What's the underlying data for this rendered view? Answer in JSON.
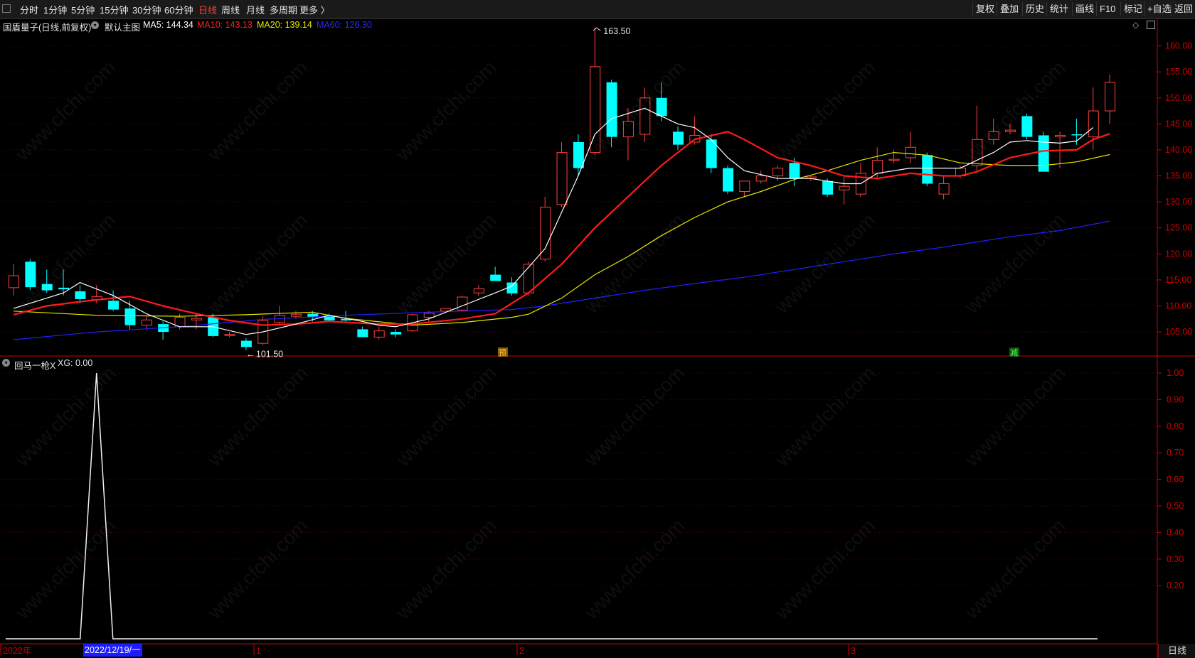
{
  "toolbar": {
    "periods": [
      "分时",
      "1分钟",
      "5分钟",
      "15分钟",
      "30分钟",
      "60分钟",
      "日线",
      "周线",
      "月线",
      "多周期",
      "更多 〉"
    ],
    "active_period": "日线",
    "right_buttons": [
      "复权",
      "叠加",
      "历史",
      "统计",
      "画线",
      "F10",
      "标记",
      "+自选",
      "返回"
    ]
  },
  "info": {
    "stock": "国盾量子(日线,前复权)",
    "template": "默认主图",
    "ma5": "MA5: 144.34",
    "ma10": "MA10: 143.13",
    "ma20": "MA20: 139.14",
    "ma60": "MA60: 126.30"
  },
  "sub": {
    "title": "回马一枪X",
    "xg": "XG: 0.00"
  },
  "colors": {
    "up": "#ff4040",
    "down": "#00ffff",
    "ma5": "#ffffff",
    "ma10": "#ff1a1a",
    "ma20": "#e6e600",
    "ma60": "#2020ff",
    "axis": "#cc0000"
  },
  "main_axis": {
    "labels": [
      "160.00",
      "155.00",
      "150.00",
      "145.00",
      "140.00",
      "135.00",
      "130.00",
      "125.00",
      "120.00",
      "115.00",
      "110.00",
      "105.00"
    ]
  },
  "sub_axis": {
    "labels": [
      "1.00",
      "0.90",
      "0.80",
      "0.70",
      "0.60",
      "0.50",
      "0.40",
      "0.30",
      "0.20"
    ]
  },
  "annotations": {
    "high": "163.50",
    "low": "101.50",
    "yu": "预",
    "jian": "减"
  },
  "xaxis": {
    "labels": [
      "2022年",
      "1",
      "2",
      "3"
    ],
    "cursor_date": "2022/12/19/一"
  },
  "bottom_right": "日线",
  "watermark": "www.cfchi.com",
  "chart_data": {
    "type": "candlestick",
    "x_range": [
      1,
      66
    ],
    "ylim": [
      100.5,
      165
    ],
    "candles": [
      {
        "o": 113.5,
        "h": 118,
        "l": 112,
        "c": 115.8
      },
      {
        "o": 118.5,
        "h": 119,
        "l": 113,
        "c": 113.6
      },
      {
        "o": 114.2,
        "h": 117,
        "l": 112.5,
        "c": 113
      },
      {
        "o": 113.5,
        "h": 117,
        "l": 112,
        "c": 113.2
      },
      {
        "o": 112.8,
        "h": 114,
        "l": 110.5,
        "c": 111.3
      },
      {
        "o": 111.2,
        "h": 114,
        "l": 110.5,
        "c": 111.8
      },
      {
        "o": 111,
        "h": 113,
        "l": 109,
        "c": 109.3
      },
      {
        "o": 109.5,
        "h": 111,
        "l": 105.5,
        "c": 106.3
      },
      {
        "o": 106.3,
        "h": 108,
        "l": 105.5,
        "c": 107.3
      },
      {
        "o": 106.5,
        "h": 107,
        "l": 103.5,
        "c": 105
      },
      {
        "o": 106,
        "h": 108.5,
        "l": 105.5,
        "c": 107.8
      },
      {
        "o": 107.3,
        "h": 108.5,
        "l": 105.5,
        "c": 107.6
      },
      {
        "o": 107.8,
        "h": 108.5,
        "l": 104,
        "c": 104.2
      },
      {
        "o": 104.3,
        "h": 105,
        "l": 104,
        "c": 104.5
      },
      {
        "o": 103.3,
        "h": 103.8,
        "l": 101.5,
        "c": 102.1
      },
      {
        "o": 102.8,
        "h": 108,
        "l": 102.5,
        "c": 107.2
      },
      {
        "o": 106.8,
        "h": 110,
        "l": 106.5,
        "c": 108.2
      },
      {
        "o": 108,
        "h": 109,
        "l": 107.5,
        "c": 108.4
      },
      {
        "o": 108.5,
        "h": 109,
        "l": 107,
        "c": 107.8
      },
      {
        "o": 108,
        "h": 108.5,
        "l": 107,
        "c": 107.2
      },
      {
        "o": 107.5,
        "h": 109,
        "l": 107,
        "c": 107.2
      },
      {
        "o": 105.5,
        "h": 106,
        "l": 104,
        "c": 104
      },
      {
        "o": 104,
        "h": 106,
        "l": 103.5,
        "c": 105.2
      },
      {
        "o": 105,
        "h": 105.5,
        "l": 104,
        "c": 104.5
      },
      {
        "o": 105.2,
        "h": 108.5,
        "l": 105,
        "c": 108.3
      },
      {
        "o": 107.8,
        "h": 109,
        "l": 107,
        "c": 108.6
      },
      {
        "o": 109,
        "h": 109.5,
        "l": 108.5,
        "c": 109.5
      },
      {
        "o": 109.2,
        "h": 112,
        "l": 109,
        "c": 111.7
      },
      {
        "o": 112.5,
        "h": 114,
        "l": 112,
        "c": 113.3
      },
      {
        "o": 116,
        "h": 117.5,
        "l": 114.8,
        "c": 114.8
      },
      {
        "o": 114.5,
        "h": 115.5,
        "l": 112,
        "c": 112.4
      },
      {
        "o": 112.5,
        "h": 118.5,
        "l": 112,
        "c": 118
      },
      {
        "o": 119,
        "h": 131,
        "l": 118.5,
        "c": 129
      },
      {
        "o": 129.5,
        "h": 141.5,
        "l": 129,
        "c": 139.5
      },
      {
        "o": 141.5,
        "h": 143,
        "l": 135,
        "c": 136.5
      },
      {
        "o": 139.5,
        "h": 163.5,
        "l": 139,
        "c": 156
      },
      {
        "o": 153,
        "h": 153.5,
        "l": 140.5,
        "c": 142.5
      },
      {
        "o": 142.5,
        "h": 148,
        "l": 138,
        "c": 145.5
      },
      {
        "o": 143,
        "h": 152,
        "l": 141.5,
        "c": 150
      },
      {
        "o": 150,
        "h": 153,
        "l": 145.5,
        "c": 146.5
      },
      {
        "o": 143.5,
        "h": 144.5,
        "l": 140,
        "c": 141
      },
      {
        "o": 141.5,
        "h": 146.5,
        "l": 141,
        "c": 142.8
      },
      {
        "o": 142,
        "h": 143,
        "l": 135.5,
        "c": 136.5
      },
      {
        "o": 136.5,
        "h": 137,
        "l": 131.5,
        "c": 132
      },
      {
        "o": 132,
        "h": 134,
        "l": 131,
        "c": 134
      },
      {
        "o": 134,
        "h": 136,
        "l": 133.5,
        "c": 135
      },
      {
        "o": 135,
        "h": 137,
        "l": 134,
        "c": 136.5
      },
      {
        "o": 137.5,
        "h": 138.5,
        "l": 133,
        "c": 134.5
      },
      {
        "o": 134.5,
        "h": 135,
        "l": 134,
        "c": 134.8
      },
      {
        "o": 134,
        "h": 134.5,
        "l": 131,
        "c": 131.4
      },
      {
        "o": 132.3,
        "h": 135,
        "l": 129.5,
        "c": 133
      },
      {
        "o": 131.5,
        "h": 137.5,
        "l": 131,
        "c": 135.5
      },
      {
        "o": 135.5,
        "h": 140.5,
        "l": 134.5,
        "c": 138
      },
      {
        "o": 138,
        "h": 140,
        "l": 137.5,
        "c": 138.2
      },
      {
        "o": 138.5,
        "h": 143.5,
        "l": 137.5,
        "c": 140.5
      },
      {
        "o": 139,
        "h": 139.5,
        "l": 133,
        "c": 133.5
      },
      {
        "o": 131.5,
        "h": 135,
        "l": 130.5,
        "c": 133.5
      },
      {
        "o": 135,
        "h": 137,
        "l": 134.5,
        "c": 136.5
      },
      {
        "o": 137,
        "h": 148.5,
        "l": 136,
        "c": 142
      },
      {
        "o": 142,
        "h": 146,
        "l": 141,
        "c": 143.5
      },
      {
        "o": 143.5,
        "h": 145,
        "l": 143,
        "c": 143.8
      },
      {
        "o": 146.5,
        "h": 147,
        "l": 142,
        "c": 142.5
      },
      {
        "o": 142.8,
        "h": 143.5,
        "l": 135.8,
        "c": 135.8
      },
      {
        "o": 142.5,
        "h": 143.5,
        "l": 136.5,
        "c": 142.8
      },
      {
        "o": 143,
        "h": 146,
        "l": 141,
        "c": 142.8
      },
      {
        "o": 142.5,
        "h": 152,
        "l": 140,
        "c": 147.5
      },
      {
        "o": 147.5,
        "h": 154.5,
        "l": 145,
        "c": 153
      }
    ],
    "ma5": [
      [
        0,
        109.5
      ],
      [
        3,
        112.5
      ],
      [
        4,
        114.5
      ],
      [
        6,
        112
      ],
      [
        8,
        108.5
      ],
      [
        10,
        106
      ],
      [
        12,
        106
      ],
      [
        14,
        104.5
      ],
      [
        15,
        105
      ],
      [
        17,
        106.5
      ],
      [
        19,
        108.2
      ],
      [
        21,
        107
      ],
      [
        22,
        106.3
      ],
      [
        23,
        106
      ],
      [
        25,
        107.5
      ],
      [
        27,
        110
      ],
      [
        29,
        112.5
      ],
      [
        30,
        113.8
      ],
      [
        32,
        121
      ],
      [
        33,
        128
      ],
      [
        34,
        135
      ],
      [
        35,
        143
      ],
      [
        36,
        146
      ],
      [
        38,
        148
      ],
      [
        39,
        146.5
      ],
      [
        40,
        145
      ],
      [
        41,
        144.3
      ],
      [
        42,
        142
      ],
      [
        43,
        138.5
      ],
      [
        44,
        136
      ],
      [
        46,
        134.5
      ],
      [
        48,
        134.5
      ],
      [
        50,
        133.5
      ],
      [
        51,
        133.5
      ],
      [
        52,
        135.5
      ],
      [
        54,
        136.5
      ],
      [
        56,
        136.5
      ],
      [
        57,
        136.5
      ],
      [
        58,
        138
      ],
      [
        59,
        139.5
      ],
      [
        60,
        141.5
      ],
      [
        61,
        141.8
      ],
      [
        62,
        141.5
      ],
      [
        63,
        141.3
      ],
      [
        64,
        141.7
      ],
      [
        65,
        144.3
      ]
    ],
    "ma10": [
      [
        0,
        108.3
      ],
      [
        2,
        110
      ],
      [
        4,
        110.8
      ],
      [
        6,
        111.5
      ],
      [
        7,
        111.8
      ],
      [
        9,
        110
      ],
      [
        11,
        108.5
      ],
      [
        13,
        107.2
      ],
      [
        15,
        106.3
      ],
      [
        17,
        106.5
      ],
      [
        19,
        107
      ],
      [
        22,
        106.5
      ],
      [
        24,
        106.5
      ],
      [
        27,
        107.5
      ],
      [
        29,
        108.5
      ],
      [
        30,
        110.5
      ],
      [
        31,
        112.5
      ],
      [
        33,
        118
      ],
      [
        35,
        125
      ],
      [
        37,
        131
      ],
      [
        39,
        137
      ],
      [
        41,
        142
      ],
      [
        43,
        143.5
      ],
      [
        44,
        142
      ],
      [
        46,
        138.5
      ],
      [
        48,
        137
      ],
      [
        50,
        135
      ],
      [
        52,
        134.5
      ],
      [
        54,
        135.5
      ],
      [
        56,
        135
      ],
      [
        57,
        135
      ],
      [
        58,
        135.8
      ],
      [
        60,
        138.5
      ],
      [
        62,
        139.8
      ],
      [
        64,
        140
      ],
      [
        65,
        142
      ],
      [
        66,
        143.1
      ]
    ],
    "ma20": [
      [
        0,
        109
      ],
      [
        5,
        108.2
      ],
      [
        10,
        108
      ],
      [
        14,
        108.3
      ],
      [
        18,
        108.8
      ],
      [
        20,
        107.6
      ],
      [
        24,
        106.3
      ],
      [
        27,
        106.8
      ],
      [
        30,
        107.8
      ],
      [
        31,
        108.4
      ],
      [
        33,
        111.5
      ],
      [
        35,
        116
      ],
      [
        37,
        119.5
      ],
      [
        39,
        123.5
      ],
      [
        41,
        127
      ],
      [
        43,
        130
      ],
      [
        45,
        132
      ],
      [
        47,
        134.3
      ],
      [
        49,
        136
      ],
      [
        51,
        138
      ],
      [
        53,
        139.5
      ],
      [
        55,
        139
      ],
      [
        57,
        137.5
      ],
      [
        60,
        137
      ],
      [
        62,
        137
      ],
      [
        64,
        137.7
      ],
      [
        66,
        139.1
      ]
    ],
    "ma60": [
      [
        0,
        103.5
      ],
      [
        5,
        105
      ],
      [
        10,
        106
      ],
      [
        15,
        107.4
      ],
      [
        20,
        108.2
      ],
      [
        25,
        108.8
      ],
      [
        30,
        109.3
      ],
      [
        32,
        110
      ],
      [
        35,
        111.5
      ],
      [
        38,
        113
      ],
      [
        41,
        114.3
      ],
      [
        44,
        115.5
      ],
      [
        47,
        117
      ],
      [
        50,
        118.5
      ],
      [
        53,
        120
      ],
      [
        56,
        121.3
      ],
      [
        58,
        122.3
      ],
      [
        60,
        123.3
      ],
      [
        63,
        124.5
      ],
      [
        66,
        126.3
      ]
    ],
    "xg_series": {
      "name": "XG",
      "peak_index": 5,
      "peak_value": 1.0,
      "base_value": 0.0
    }
  }
}
